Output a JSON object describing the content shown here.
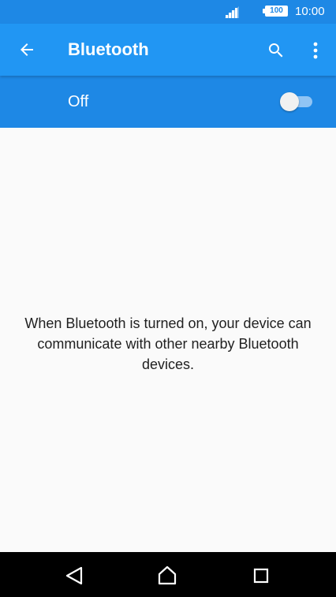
{
  "status_bar": {
    "time": "10:00",
    "battery_level": "100",
    "icons": [
      "signal-icon",
      "battery-icon"
    ]
  },
  "toolbar": {
    "title": "Bluetooth",
    "icons": [
      "back-arrow-icon",
      "search-icon",
      "more-vert-icon"
    ]
  },
  "switch_bar": {
    "label": "Off",
    "enabled": false
  },
  "main": {
    "message": "When Bluetooth is turned on, your device can communicate with other nearby Bluetooth devices."
  },
  "nav_bar": {
    "icons": [
      "nav-back-icon",
      "nav-home-icon",
      "nav-recents-icon"
    ]
  },
  "colors": {
    "status_bar": "#1e88e5",
    "toolbar": "#2196f3",
    "switch_bar": "#1e88e5",
    "background": "#fafafa",
    "nav_bar": "#000000"
  }
}
